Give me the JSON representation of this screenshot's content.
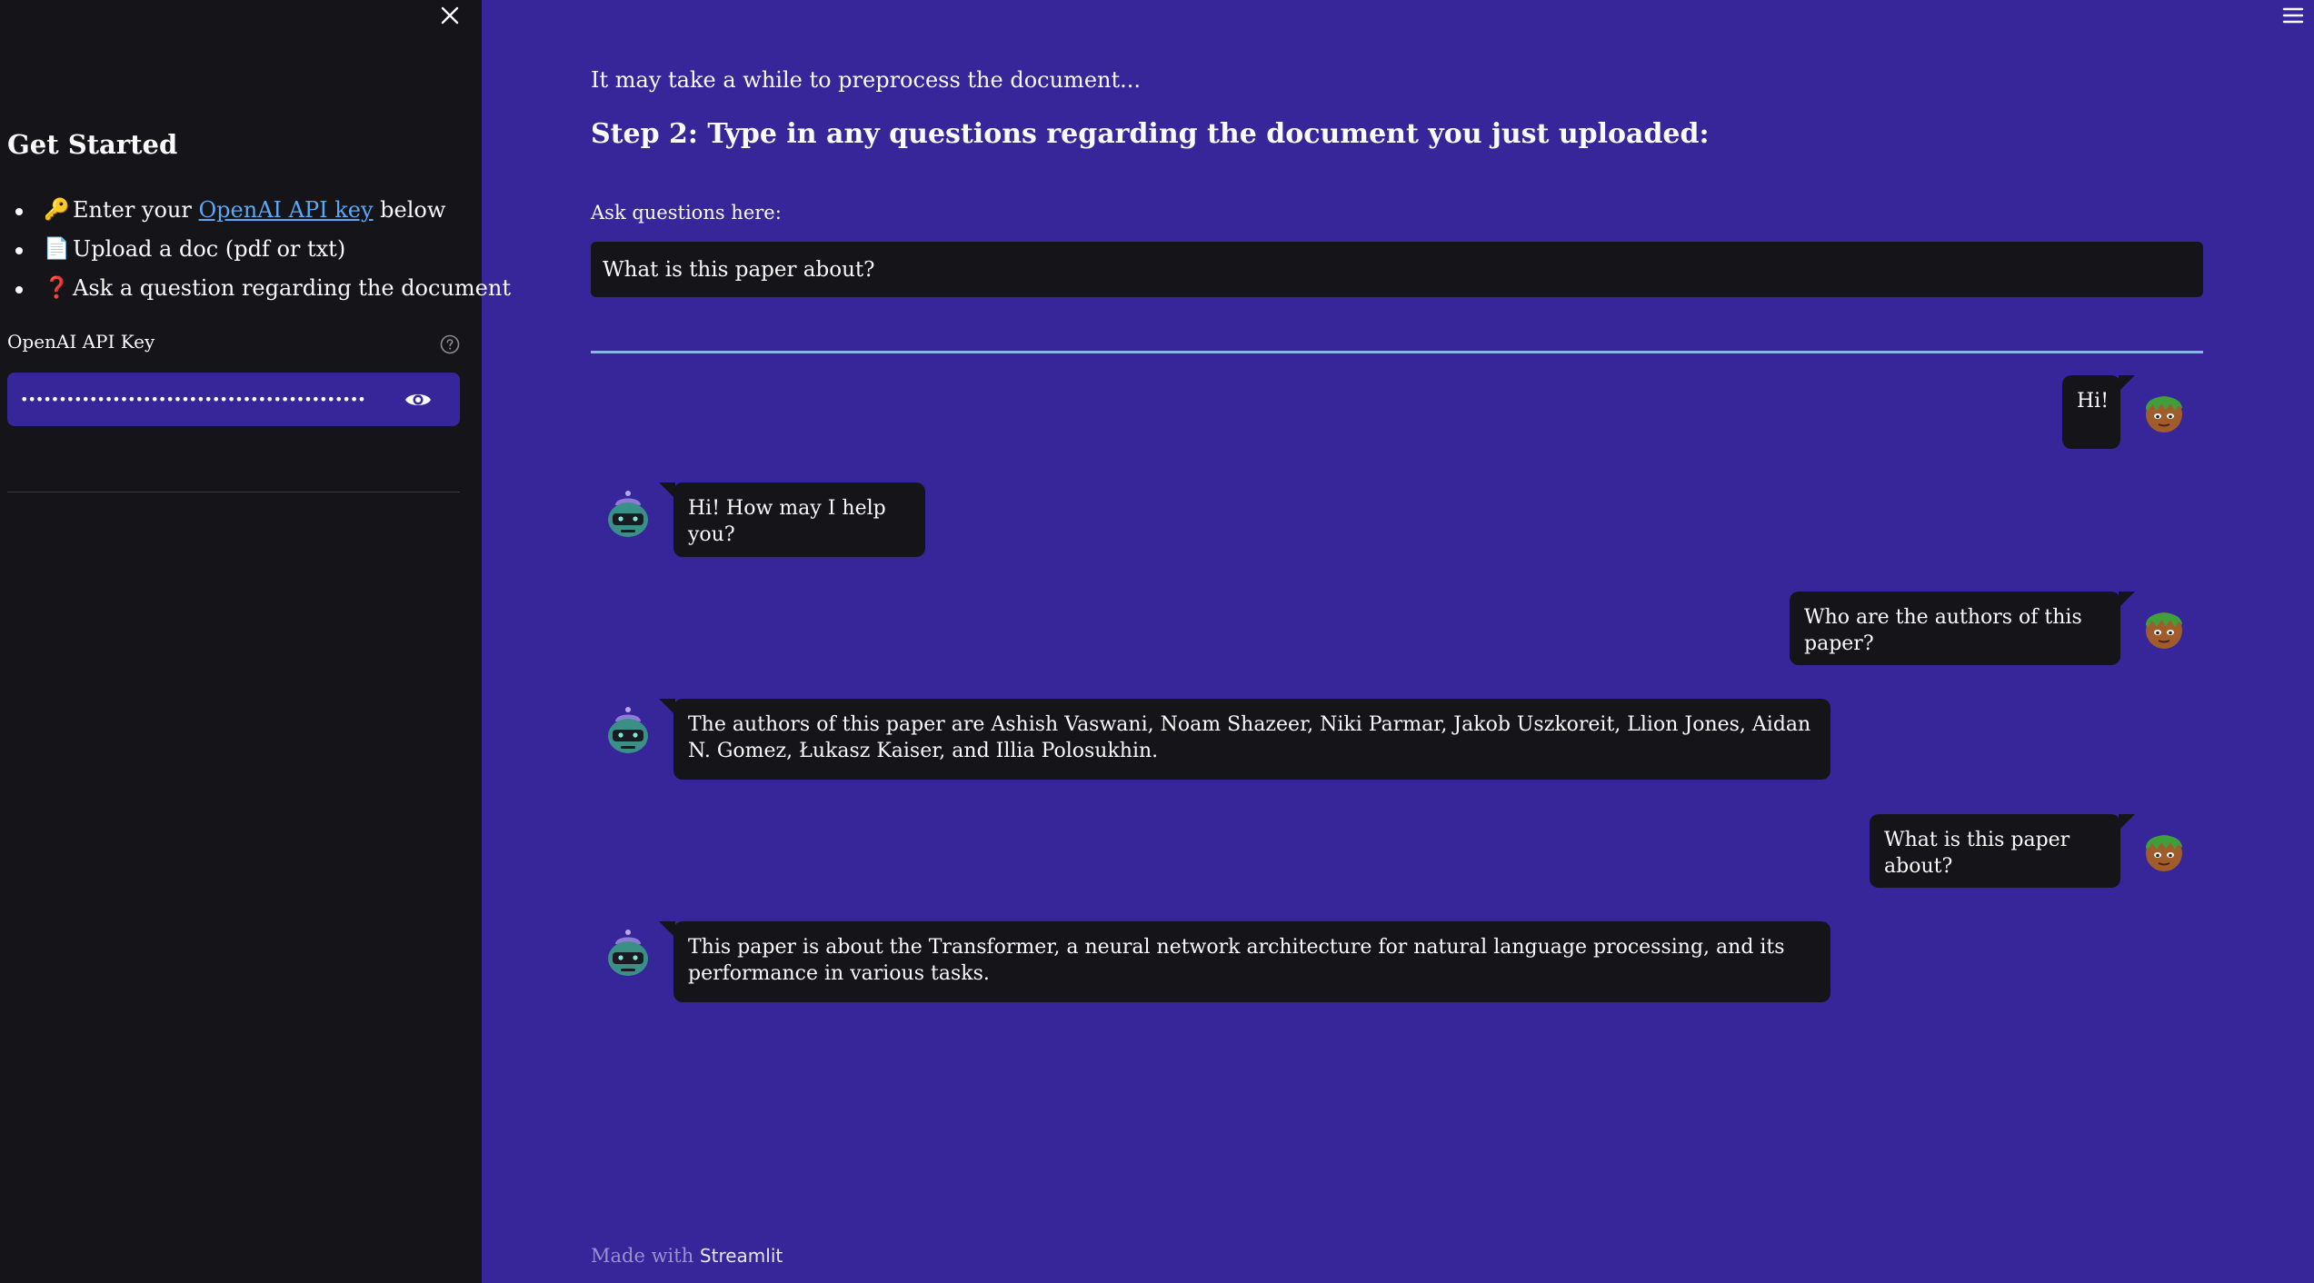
{
  "sidebar": {
    "close_icon": "close-icon",
    "title": "Get Started",
    "items": [
      {
        "emoji": "🔑",
        "prefix": "Enter your ",
        "link": "OpenAI API key",
        "suffix": " below"
      },
      {
        "emoji": "📄",
        "text": "Upload a doc (pdf or txt)"
      },
      {
        "emoji": "❓",
        "text": "Ask a question regarding the document"
      }
    ],
    "api_key_label": "OpenAI API Key",
    "api_key_value": "••••••••••••••••••••••••••••••••••••••••••••••••••",
    "help_icon": "help-icon",
    "eye_icon": "eye-icon"
  },
  "main": {
    "note": "It may take a while to preprocess the document...",
    "step_title": "Step 2: Type in any questions regarding the document you just uploaded:",
    "ask_label": "Ask questions here:",
    "question_value": "What is this paper about?"
  },
  "chat": [
    {
      "role": "user",
      "text": "Hi!"
    },
    {
      "role": "bot",
      "text": "Hi! How may I help you?"
    },
    {
      "role": "user",
      "text": "Who are the authors of this paper?"
    },
    {
      "role": "bot",
      "text": "The authors of this paper are Ashish Vaswani, Noam Shazeer, Niki Parmar, Jakob Uszkoreit, Llion Jones, Aidan N. Gomez, Łukasz Kaiser, and Illia Polosukhin."
    },
    {
      "role": "user",
      "text": "What is this paper about?"
    },
    {
      "role": "bot",
      "text": "This paper is about the Transformer, a neural network architecture for natural language processing, and its performance in various tasks."
    }
  ],
  "footer": {
    "prefix": "Made with ",
    "brand": "Streamlit"
  },
  "colors": {
    "main_bg": "#37259a",
    "sidebar_bg": "#151519",
    "bubble_bg": "#151519",
    "link": "#5ba8f5",
    "rule": "#8fb3ec"
  }
}
